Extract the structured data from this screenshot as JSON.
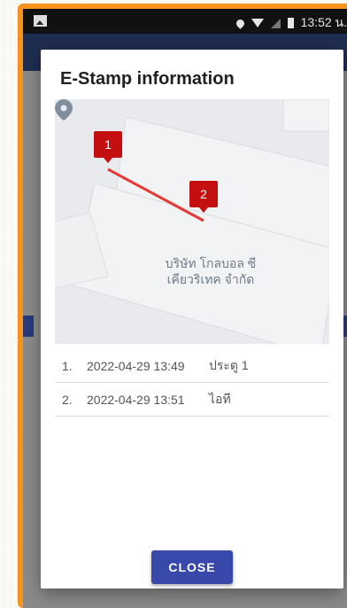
{
  "status_bar": {
    "time": "13:52 น."
  },
  "dialog": {
    "title": "E-Stamp information",
    "map": {
      "markers": [
        {
          "label": "1"
        },
        {
          "label": "2"
        }
      ],
      "place_label_line1": "บริษัท โกลบอล ซี",
      "place_label_line2": "เคียวริเทค จำกัด"
    },
    "stamps": [
      {
        "index": "1.",
        "datetime": "2022-04-29 13:49",
        "place": "ประตู 1"
      },
      {
        "index": "2.",
        "datetime": "2022-04-29 13:51",
        "place": "ไอที"
      }
    ],
    "close_label": "CLOSE"
  },
  "colors": {
    "frame": "#f5931e",
    "route": "#e53935",
    "marker": "#c30f0f",
    "button": "#3949ab"
  }
}
